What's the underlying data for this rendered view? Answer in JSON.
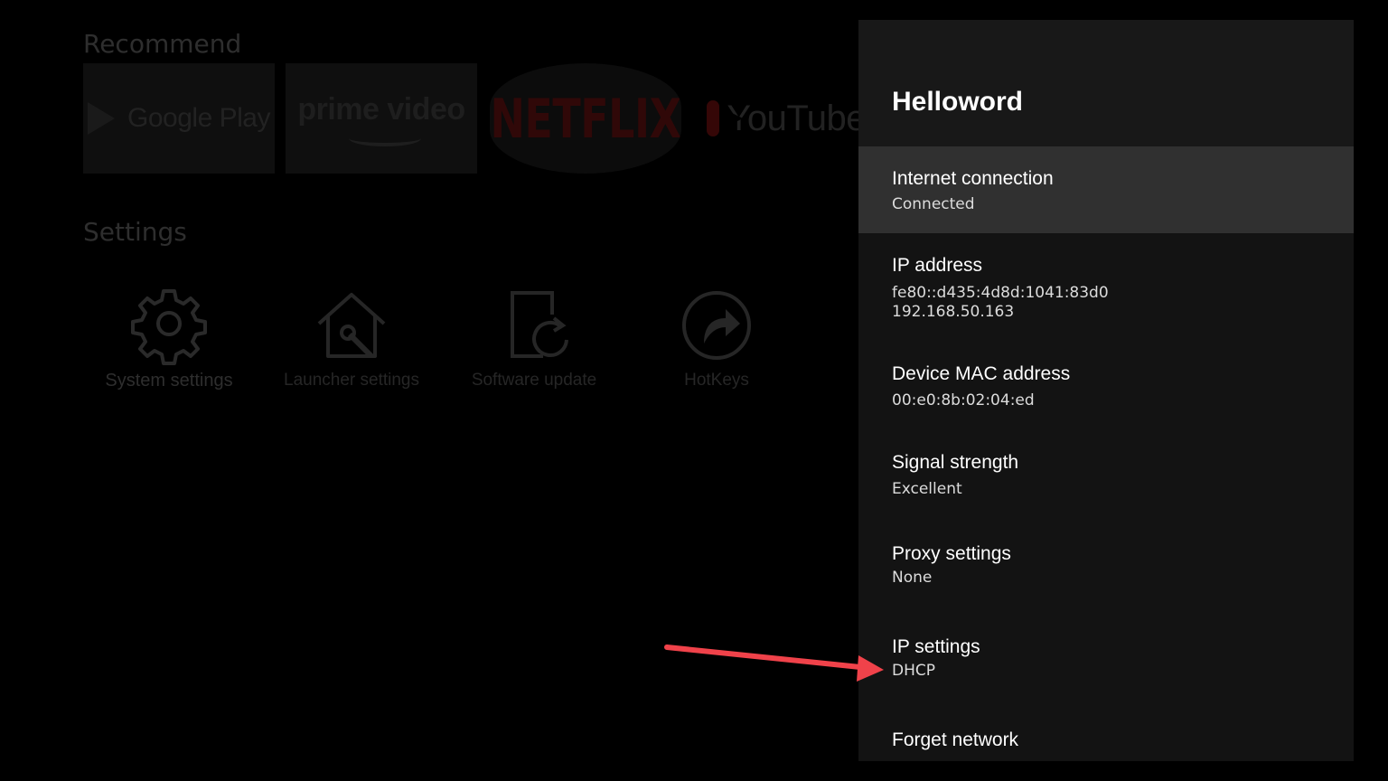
{
  "launcher": {
    "recommend_title": "Recommend",
    "settings_title": "Settings",
    "apps": [
      {
        "name": "Google Play",
        "icon": "google-play-logo"
      },
      {
        "name": "prime video",
        "icon": "prime-video-logo"
      },
      {
        "name": "NETFLIX",
        "icon": "netflix-logo"
      },
      {
        "name": "YouTube",
        "icon": "youtube-logo"
      }
    ],
    "settings_items": [
      {
        "label": "System settings",
        "icon": "gear-icon"
      },
      {
        "label": "Launcher settings",
        "icon": "home-wrench-icon"
      },
      {
        "label": "Software update",
        "icon": "update-icon"
      },
      {
        "label": "HotKeys",
        "icon": "hotkey-arrow-icon"
      }
    ]
  },
  "panel": {
    "title": "Helloword",
    "items": [
      {
        "title": "Internet connection",
        "subtitle": "Connected"
      },
      {
        "title": "IP address",
        "subtitle": "fe80::d435:4d8d:1041:83d0\n192.168.50.163",
        "lines": [
          "fe80::d435:4d8d:1041:83d0",
          "192.168.50.163"
        ]
      },
      {
        "title": "Device MAC address",
        "subtitle": "00:e0:8b:02:04:ed"
      },
      {
        "title": "Signal strength",
        "subtitle": "Excellent"
      },
      {
        "title": "Proxy settings",
        "subtitle": "None"
      },
      {
        "title": "IP settings",
        "subtitle": "DHCP"
      },
      {
        "title": "Forget network",
        "subtitle": ""
      }
    ]
  },
  "colors": {
    "panel_bg": "#131313",
    "focused_item_bg": "#303030",
    "annotation_arrow": "#f0424a"
  }
}
